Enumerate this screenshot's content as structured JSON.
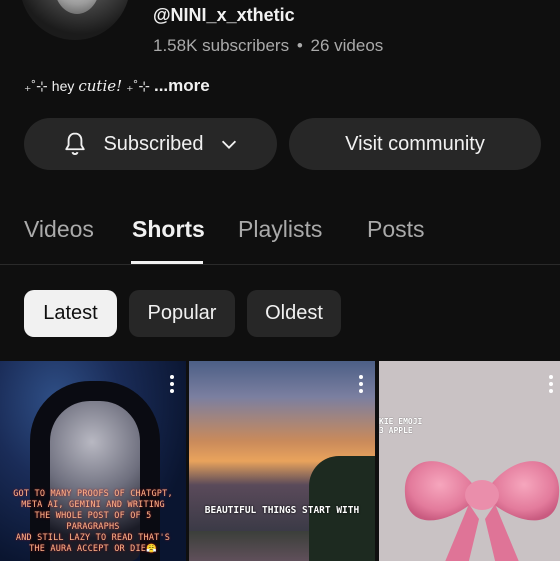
{
  "channel": {
    "handle": "@NINI_x_xthetic",
    "subscribers": "1.58K subscribers",
    "separator": "•",
    "videos": "26 videos",
    "bio": {
      "deco_left": "₊˚⊹",
      "hey": "hey",
      "cutie": "cutie!",
      "deco_right": "₊˚⊹",
      "more": "...more"
    }
  },
  "actions": {
    "subscribed_label": "Subscribed",
    "community_label": "Visit community"
  },
  "tabs": [
    {
      "label": "Videos"
    },
    {
      "label": "Shorts"
    },
    {
      "label": "Playlists"
    },
    {
      "label": "Posts"
    }
  ],
  "active_tab": "Shorts",
  "filters": [
    {
      "label": "Latest"
    },
    {
      "label": "Popular"
    },
    {
      "label": "Oldest"
    }
  ],
  "selected_filter": "Latest",
  "shorts": [
    {
      "caption_lines": [
        "GOT TO MANY PROOFS OF CHATGPT,",
        "META AI, GEMINI AND WRITING",
        "THE WHOLE POST OF OF 5 PARAGRAPHS",
        "AND STILL LAZY TO READ THAT'S",
        "THE AURA ACCEPT OR DIE😤"
      ]
    },
    {
      "caption_lines": [
        "BEAUTIFUL THINGS START WITH"
      ]
    },
    {
      "caption_lines": [
        "KIE EMOJI",
        "3 APPLE"
      ]
    }
  ],
  "colors": {
    "background": "#0f0f0f",
    "button_bg": "#272727",
    "text_primary": "#f1f1f1",
    "text_secondary": "#aaaaaa"
  }
}
